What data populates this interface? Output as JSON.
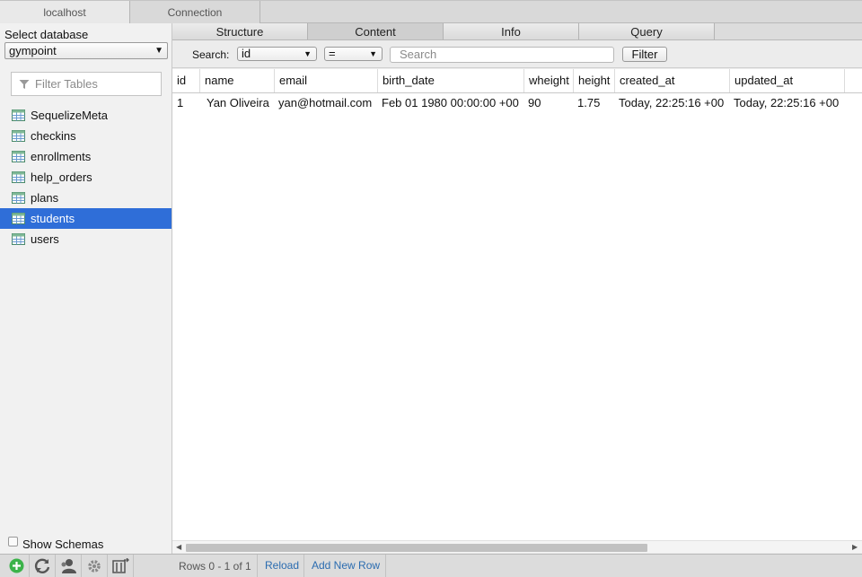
{
  "top_tabs": [
    {
      "label": "localhost"
    },
    {
      "label": "Connection"
    }
  ],
  "sidebar": {
    "db_label": "Select database",
    "db_selected": "gympoint",
    "filter_placeholder": "Filter Tables",
    "tables": [
      "SequelizeMeta",
      "checkins",
      "enrollments",
      "help_orders",
      "plans",
      "students",
      "users"
    ],
    "selected_table": "students",
    "show_schemas_label": "Show Schemas",
    "show_schemas_checked": false
  },
  "content_tabs": [
    {
      "label": "Structure"
    },
    {
      "label": "Content"
    },
    {
      "label": "Info"
    },
    {
      "label": "Query"
    }
  ],
  "active_content_tab": "Content",
  "search": {
    "label": "Search:",
    "column_selected": "id",
    "operator_selected": "=",
    "placeholder": "Search",
    "button_label": "Filter"
  },
  "grid": {
    "columns": [
      "id",
      "name",
      "email",
      "birth_date",
      "wheight",
      "height",
      "created_at",
      "updated_at"
    ],
    "rows": [
      [
        "1",
        "Yan Oliveira",
        "yan@hotmail.com",
        "Feb 01 1980 00:00:00 +00",
        "90",
        "1.75",
        "Today, 22:25:16 +00",
        "Today, 22:25:16 +00"
      ]
    ]
  },
  "footer": {
    "rows_info": "Rows 0 - 1 of 1",
    "reload_label": "Reload",
    "add_row_label": "Add New Row",
    "toolbar_icons": [
      "add-icon",
      "refresh-icon",
      "user-icon",
      "gear-icon",
      "table-export-icon"
    ]
  },
  "colors": {
    "selection": "#2f6ed8",
    "link": "#2b6cb0",
    "add_green": "#3bb34a"
  }
}
